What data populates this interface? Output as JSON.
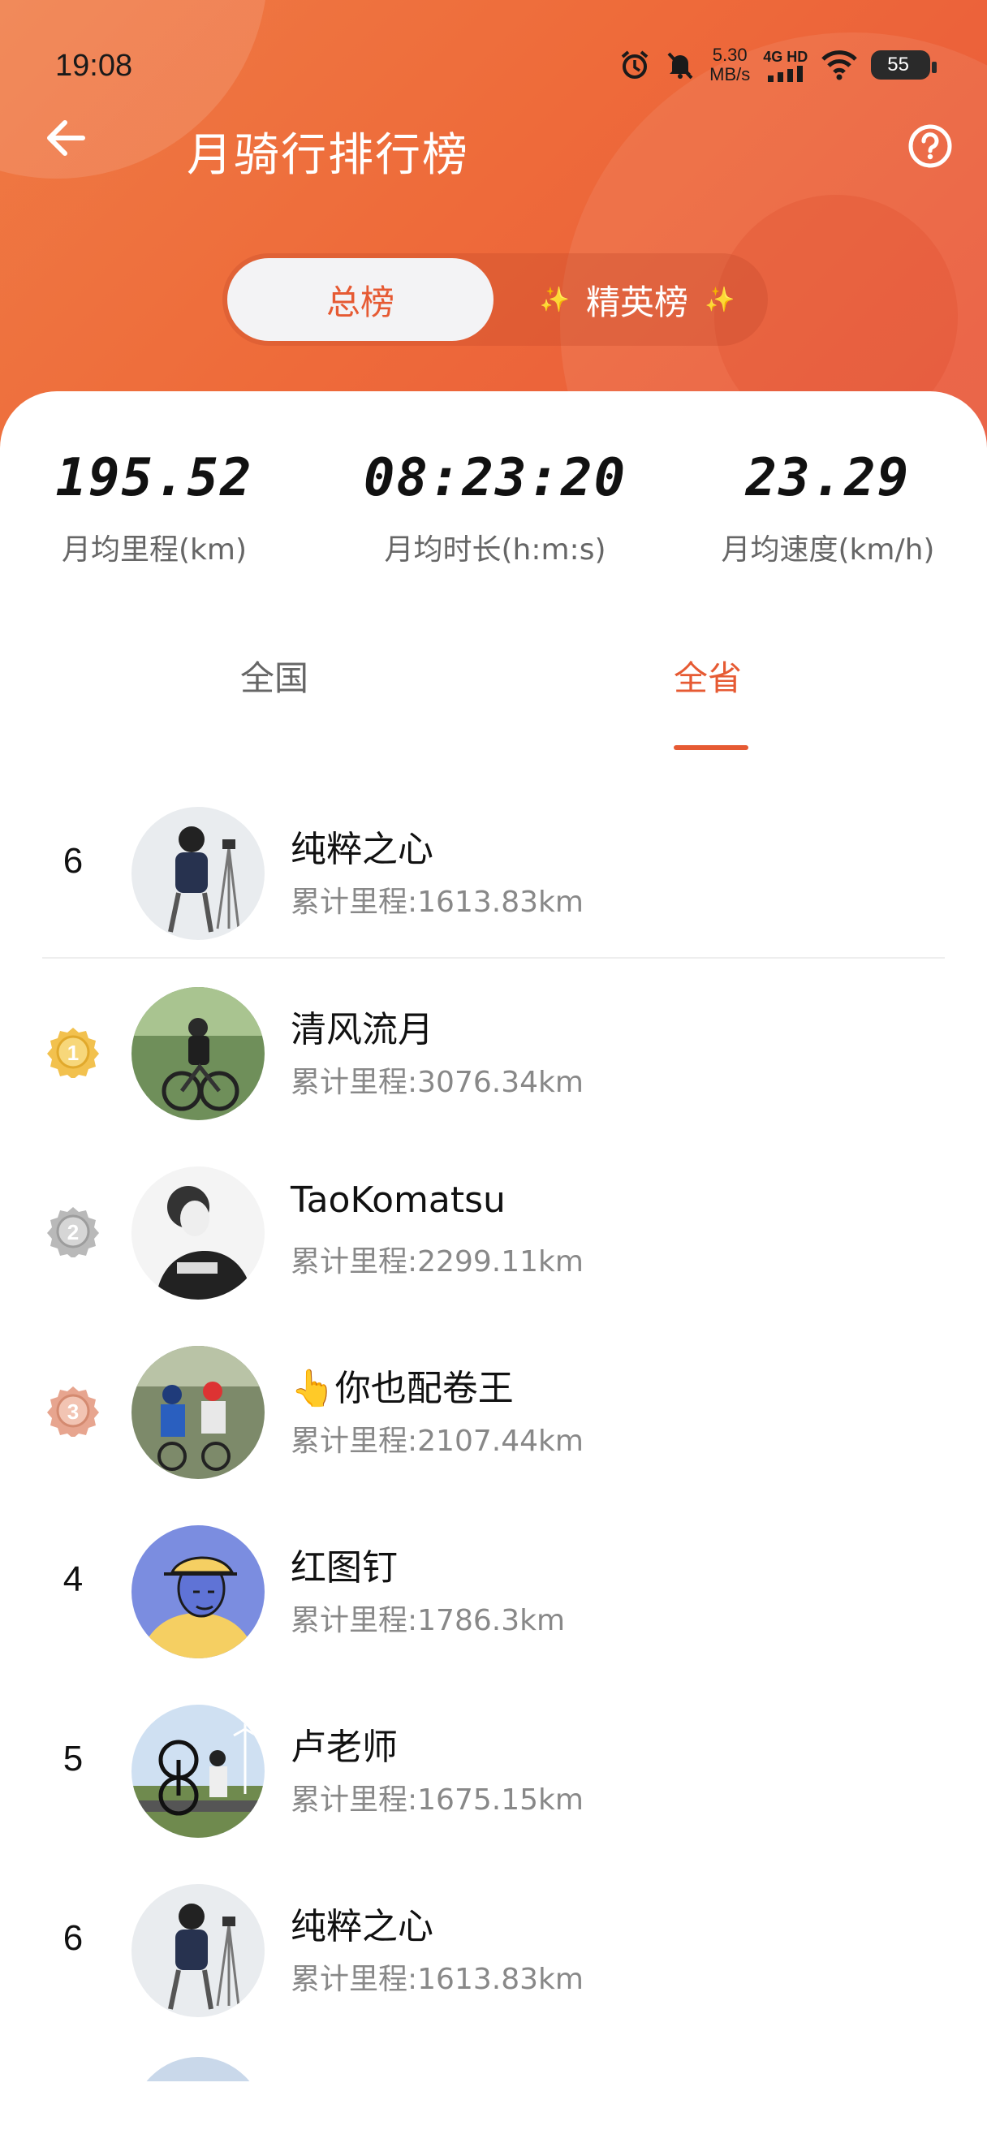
{
  "status_bar": {
    "time": "19:08",
    "net_speed": "5.30",
    "net_unit": "MB/s",
    "signal_label": "4G HD",
    "battery": "55"
  },
  "header": {
    "title": "月骑行排行榜",
    "segments": {
      "active": "总榜",
      "inactive": "精英榜"
    }
  },
  "stats": [
    {
      "value": "195.52",
      "label": "月均里程(km)"
    },
    {
      "value": "08:23:20",
      "label": "月均时长(h:m:s)"
    },
    {
      "value": "23.29",
      "label": "月均速度(km/h)"
    }
  ],
  "tabs": {
    "national": "全国",
    "province": "全省"
  },
  "my_entry": {
    "rank": "6",
    "name": "纯粹之心",
    "distance": "累计里程:1613.83km"
  },
  "leaderboard": [
    {
      "rank": "1",
      "name": "清风流月",
      "distance": "累计里程:3076.34km"
    },
    {
      "rank": "2",
      "name": "TaoKomatsu",
      "distance": "累计里程:2299.11km"
    },
    {
      "rank": "3",
      "name": "👆你也配卷王",
      "distance": "累计里程:2107.44km"
    },
    {
      "rank": "4",
      "name": "红图钉",
      "distance": "累计里程:1786.3km"
    },
    {
      "rank": "5",
      "name": "卢老师",
      "distance": "累计里程:1675.15km"
    },
    {
      "rank": "6",
      "name": "纯粹之心",
      "distance": "累计里程:1613.83km"
    }
  ],
  "colors": {
    "accent": "#e65a33",
    "gold": "#f2c14e",
    "silver": "#b9b9b9",
    "bronze": "#e7a58f"
  }
}
